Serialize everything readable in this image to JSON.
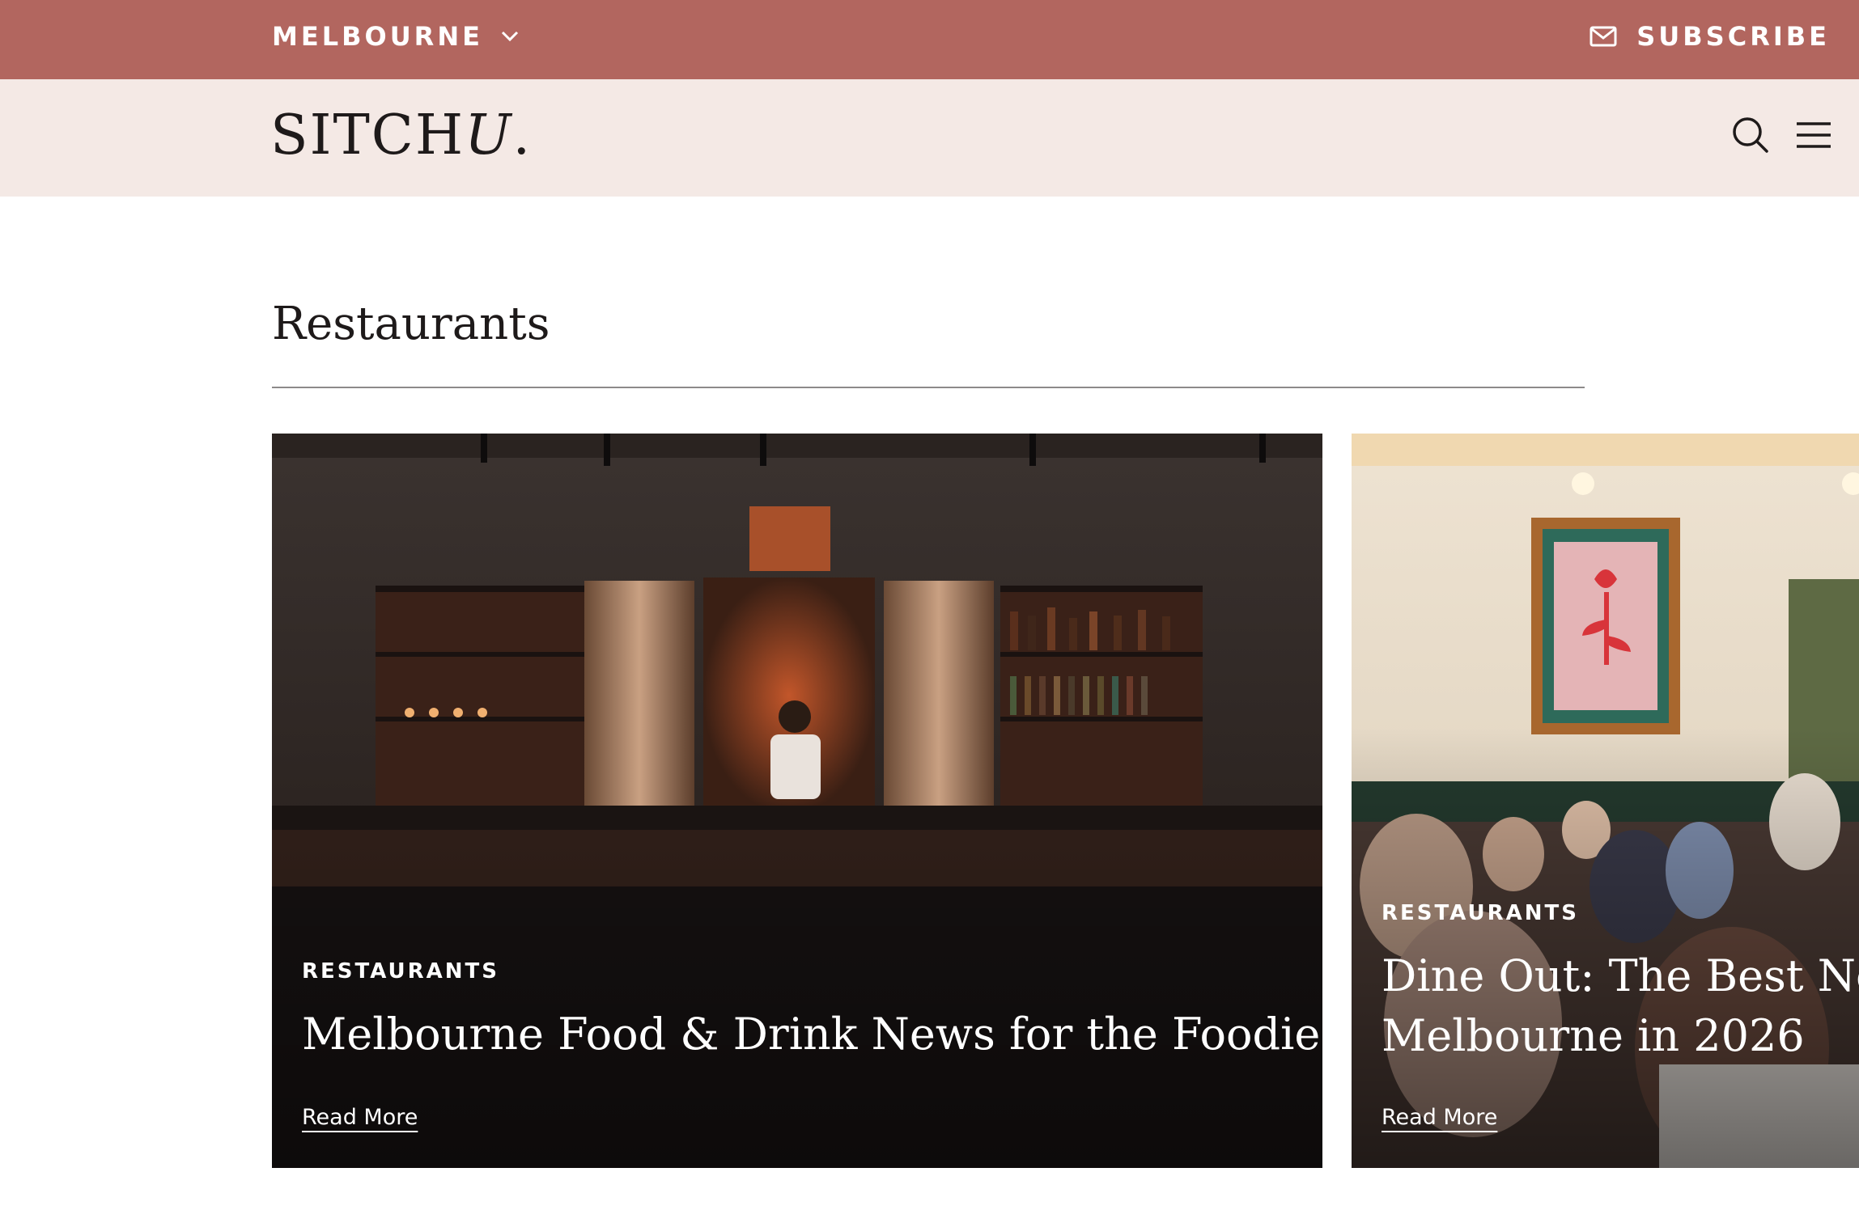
{
  "topbar": {
    "city": "MELBOURNE",
    "subscribe": "SUBSCRIBE",
    "bg_color": "#b2665f"
  },
  "header": {
    "logo_main": "SITCH",
    "logo_u": "U",
    "logo_dot": ".",
    "bg_color": "#f4e9e5",
    "icons": [
      "search-icon",
      "menu-icon"
    ]
  },
  "section": {
    "title": "Restaurants"
  },
  "cards": [
    {
      "category": "RESTAURANTS",
      "title": "Melbourne Food & Drink News for the Foodies",
      "cta": "Read More"
    },
    {
      "category": "RESTAURANTS",
      "title_line1": "Dine Out: The Best New",
      "title_line2": "Melbourne in 2026",
      "cta": "Read More"
    }
  ]
}
